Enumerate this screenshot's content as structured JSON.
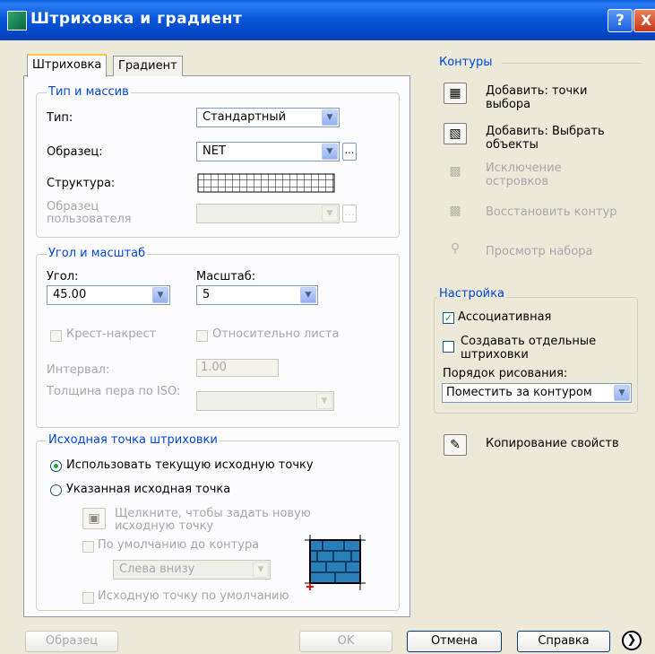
{
  "window": {
    "title": "Штриховка и градиент",
    "help_glyph": "?",
    "close_glyph": "X"
  },
  "tabs": [
    {
      "label": "Штриховка",
      "active": true
    },
    {
      "label": "Градиент",
      "active": false
    }
  ],
  "type_pattern": {
    "title": "Тип и массив",
    "type_label": "Тип:",
    "type_value": "Стандартный",
    "pattern_label": "Образец:",
    "pattern_value": "NET",
    "structure_label": "Структура:",
    "custom_label": "Образец пользователя"
  },
  "angle_scale": {
    "title": "Угол и масштаб",
    "angle_label": "Угол:",
    "angle_value": "45.00",
    "scale_label": "Масштаб:",
    "scale_value": "5",
    "double_label": "Крест-накрест",
    "relative_label": "Относительно листа",
    "spacing_label": "Интервал:",
    "spacing_value": "1.00",
    "iso_label": "Толщина пера по ISO:"
  },
  "origin": {
    "title": "Исходная точка штриховки",
    "use_current_label": "Использовать текущую исходную точку",
    "specified_label": "Указанная исходная точка",
    "click_label": "Щелкните, чтобы задать новую исходную точку",
    "default_extents_label": "По умолчанию до контура",
    "position_value": "Слева внизу",
    "store_default_label": "Исходную точку по умолчанию"
  },
  "boundaries": {
    "title": "Контуры",
    "add_pick_label": "Добавить: точки выбора",
    "add_select_label": "Добавить: Выбрать объекты",
    "remove_islands_label": "Исключение островков",
    "recreate_label": "Восстановить контур",
    "view_label": "Просмотр набора"
  },
  "options": {
    "title": "Настройка",
    "associative_label": "Ассоциативная",
    "associative_checked": true,
    "separate_label": "Создавать отдельные штриховки",
    "separate_checked": false,
    "draw_order_label": "Порядок рисования:",
    "draw_order_value": "Поместить за контуром"
  },
  "inherit_label": "Копирование свойств",
  "footer": {
    "preview_label": "Образец",
    "ok_label": "OK",
    "cancel_label": "Отмена",
    "help_label": "Справка"
  },
  "icons": {
    "title_icon": "hatch-icon",
    "add_pick": "pick-points-icon",
    "add_select": "select-objects-icon",
    "remove_islands": "remove-islands-icon",
    "recreate": "recreate-boundary-icon",
    "view": "magnifier-icon",
    "inherit": "inherit-properties-icon",
    "more": "chevron-right-icon",
    "swatch": "hatch-swatch-icon"
  }
}
